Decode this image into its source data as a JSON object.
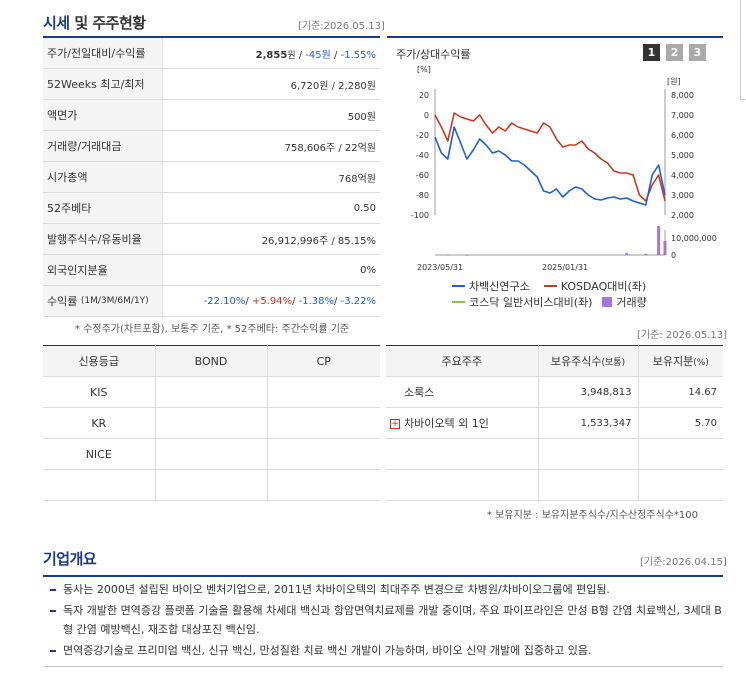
{
  "market": {
    "title_accent": "시세",
    "title_rest": " 및 주주현황",
    "date": "[기준:2026.05.13]",
    "rows": [
      {
        "label": "주가/전일대비/수익률",
        "price": "2,855",
        "unit": "원",
        "sep1": " / ",
        "change": "-45원",
        "sep2": " / ",
        "rate": "-1.55%"
      },
      {
        "label": "52Weeks 최고/최저",
        "value": "6,720원 / 2,280원"
      },
      {
        "label": "액면가",
        "value": "500원"
      },
      {
        "label": "거래량/거래대금",
        "value": "758,606주 / 22억원"
      },
      {
        "label": "시가총액",
        "value": "768억원"
      },
      {
        "label": "52주베타",
        "value": "0.50"
      },
      {
        "label": "발행주식수/유동비율",
        "value": "26,912,996주 / 85.15%"
      },
      {
        "label": "외국인지분율",
        "value": "0%"
      },
      {
        "label": "수익률",
        "label_sub": "(1M/3M/6M/1Y)",
        "r1": "-22.10%",
        "r2": "+5.94%",
        "r3": "-1.38%",
        "r4": "-3.22%",
        "slash": "/ "
      }
    ],
    "footnote": "* 수정주가(차트포함), 보통주 기준, * 52주베타: 주간수익률 기준"
  },
  "chart_panel": {
    "title": "주가/상대수익률",
    "tabs": [
      "1",
      "2",
      "3"
    ],
    "date": "[기준: 2026.05.13]"
  },
  "chart_data": {
    "type": "line",
    "left_axis_unit": "[%]",
    "right_axis_unit": "[원]",
    "left_ticks": [
      "20",
      "0",
      "-20",
      "-40",
      "-60",
      "-80",
      "-100"
    ],
    "left_ylim": [
      -100,
      20
    ],
    "right_ticks": [
      "8,000",
      "7,000",
      "6,000",
      "5,000",
      "4,000",
      "3,000",
      "2,000"
    ],
    "right_ylim": [
      2000,
      8000
    ],
    "volume_ticks": [
      "10,000,000",
      "0"
    ],
    "volume_ylim": [
      0,
      15000000
    ],
    "x_tick_labels": [
      "2023/05/31",
      "2025/01/31"
    ],
    "x": [
      0,
      1,
      2,
      3,
      4,
      5,
      6,
      7,
      8,
      9,
      10,
      11,
      12,
      13,
      14,
      15,
      16,
      17,
      18,
      19,
      20,
      21,
      22,
      23,
      24,
      25,
      26,
      27,
      28,
      29,
      30,
      31,
      32,
      33,
      34,
      35,
      36
    ],
    "series": [
      {
        "name": "차백신연구소",
        "color": "#1f5fd6",
        "axis": "left",
        "values": [
          -22,
          -38,
          -44,
          -12,
          -28,
          -44,
          -35,
          -24,
          -30,
          -38,
          -36,
          -40,
          -46,
          -46,
          -50,
          -56,
          -62,
          -76,
          -78,
          -74,
          -82,
          -76,
          -72,
          -74,
          -80,
          -84,
          -85,
          -83,
          -82,
          -84,
          -83,
          -86,
          -88,
          -90,
          -60,
          -50,
          -80
        ]
      },
      {
        "name": "KOSDAQ대비(좌)",
        "color": "#c83a1e",
        "axis": "left",
        "values": [
          0,
          -12,
          -26,
          2,
          -2,
          -4,
          -6,
          0,
          -10,
          -18,
          -12,
          -16,
          -8,
          -12,
          -14,
          -16,
          -18,
          -8,
          -12,
          -24,
          -32,
          -30,
          -30,
          -26,
          -34,
          -38,
          -44,
          -48,
          -56,
          -58,
          -58,
          -60,
          -80,
          -86,
          -70,
          -60,
          -86
        ]
      },
      {
        "name": "코스닥 일반서비스대비(좌)",
        "color": "#8cc63e",
        "axis": "left",
        "values": []
      },
      {
        "name": "거래량",
        "color": "#a378d6",
        "axis": "volume",
        "bars": [
          [
            2,
            200000
          ],
          [
            5,
            150000
          ],
          [
            30,
            800000
          ],
          [
            33,
            500000
          ],
          [
            35,
            12500000
          ],
          [
            36,
            6000000
          ]
        ]
      }
    ]
  },
  "credit": {
    "headers": [
      "신용등급",
      "BOND",
      "CP"
    ],
    "rows": [
      [
        "KIS",
        "",
        ""
      ],
      [
        "KR",
        "",
        ""
      ],
      [
        "NICE",
        "",
        ""
      ],
      [
        "",
        "",
        ""
      ]
    ]
  },
  "shareholders": {
    "headers": [
      "주요주주",
      "보유주식수",
      "(보통)",
      "보유지분",
      "(%)"
    ],
    "rows": [
      {
        "name": "소룩스",
        "shares": "3,948,813",
        "pct": "14.67",
        "expand": false
      },
      {
        "name": "차바이오텍 외 1인",
        "shares": "1,533,347",
        "pct": "5.70",
        "expand": true
      },
      {
        "name": "",
        "shares": "",
        "pct": "",
        "expand": false
      },
      {
        "name": "",
        "shares": "",
        "pct": "",
        "expand": false
      }
    ],
    "plus_glyph": "+",
    "footnote": "* 보유지분 : 보유지분주식수/지수산정주식수*100"
  },
  "overview": {
    "title": "기업개요",
    "date": "[기준:2026.04.15]",
    "bullets": [
      "동사는 2000년 설립된 바이오 벤처기업으로, 2011년 차바이오텍의 최대주주 변경으로 차병원/차바이오그룹에 편입됨.",
      "독자 개발한 면역증강 플랫폼 기술을 활용해 차세대 백신과 항암면역치료제를 개발 중이며, 주요 파이프라인은 만성 B형 간염 치료백신, 3세대 B형 간염 예방백신, 재조합 대상포진 백신임.",
      "면역증강기술로 프리미엄 백신, 신규 백신, 만성질환 치료 백신 개발이 가능하며, 바이오 신약 개발에 집중하고 있음."
    ]
  }
}
